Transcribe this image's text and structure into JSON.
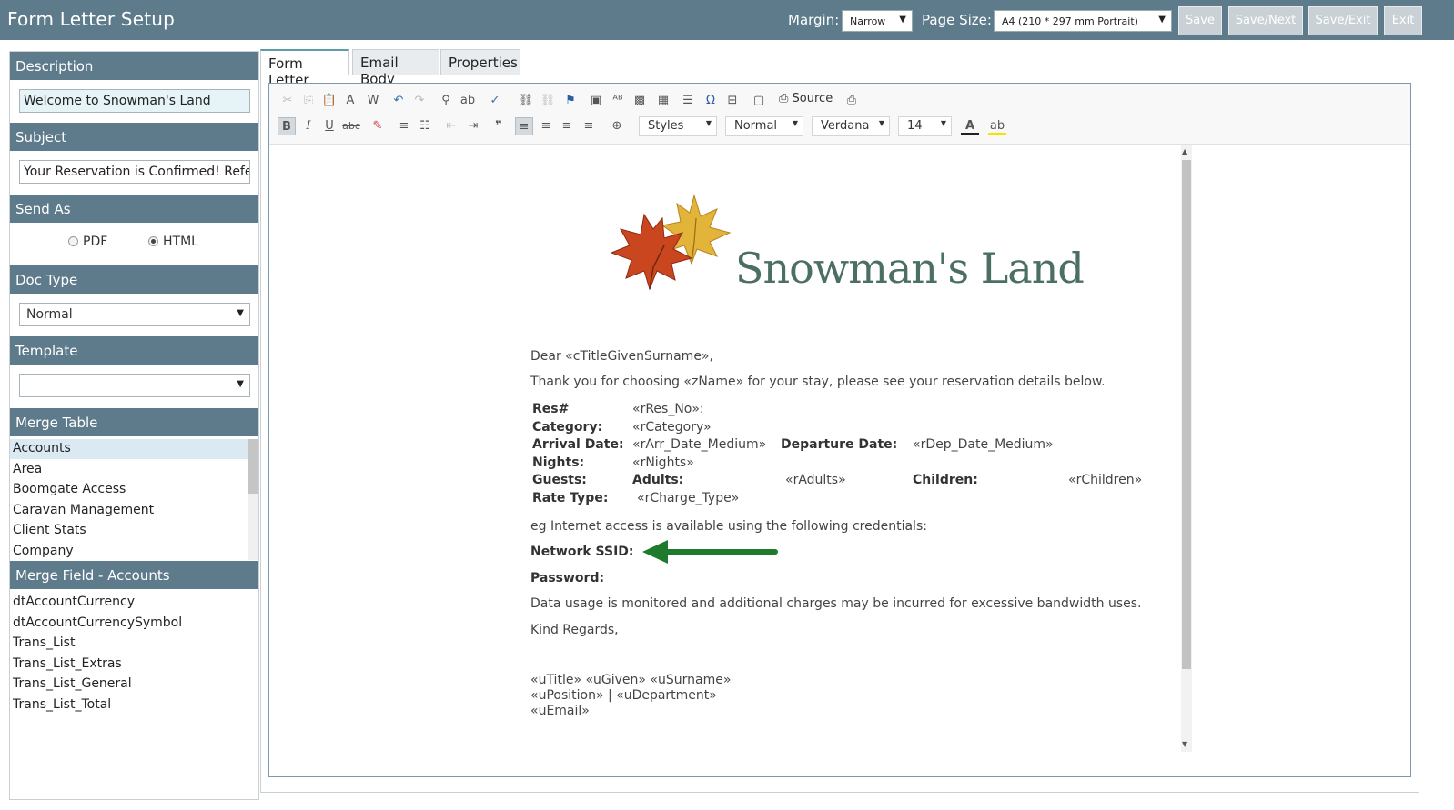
{
  "header": {
    "title": "Form Letter Setup",
    "margin_label": "Margin:",
    "margin_value": "Narrow",
    "page_size_label": "Page Size:",
    "page_size_value": "A4 (210 * 297 mm Portrait)",
    "buttons": {
      "save": "Save",
      "save_next": "Save/Next",
      "save_exit": "Save/Exit",
      "exit": "Exit"
    }
  },
  "sidebar": {
    "description_label": "Description",
    "description_value": "Welcome to Snowman's Land",
    "subject_label": "Subject",
    "subject_value": "Your Reservation is Confirmed! Refe",
    "send_as_label": "Send As",
    "send_as_options": {
      "pdf": "PDF",
      "html": "HTML"
    },
    "doc_type_label": "Doc Type",
    "doc_type_value": "Normal",
    "template_label": "Template",
    "template_value": "",
    "merge_table_label": "Merge Table",
    "merge_table_items": [
      "Accounts",
      "Area",
      "Boomgate Access",
      "Caravan Management",
      "Client Stats",
      "Company"
    ],
    "merge_field_label": "Merge Field - Accounts",
    "merge_field_items": [
      "dtAccountCurrency",
      "dtAccountCurrencySymbol",
      "Trans_List",
      "Trans_List_Extras",
      "Trans_List_General",
      "Trans_List_Total"
    ]
  },
  "tabs": {
    "form_letter": "Form Letter",
    "email_body": "Email Body",
    "properties": "Properties"
  },
  "toolbar": {
    "source": "Source",
    "styles": "Styles",
    "format": "Normal",
    "font": "Verdana",
    "size": "14"
  },
  "letter": {
    "logo_text": "Snowman's Land",
    "greeting": "Dear «cTitleGivenSurname»,",
    "intro": "Thank you for choosing «zName» for your stay, please see your reservation details below.",
    "res_label": "Res#",
    "res_value": "«rRes_No»:",
    "category_label": "Category:",
    "category_value": "«rCategory»",
    "arrival_label": "Arrival Date:",
    "arrival_value": "«rArr_Date_Medium»",
    "departure_label": "Departure Date:",
    "departure_value": "«rDep_Date_Medium»",
    "nights_label": "Nights:",
    "nights_value": "«rNights»",
    "guests_label": "Guests:",
    "adults_label": "Adults:",
    "adults_value": "«rAdults»",
    "children_label": "Children:",
    "children_value": "«rChildren»",
    "rate_label": "Rate Type:",
    "rate_value": "«rCharge_Type»",
    "internet_line": "eg Internet access is available using the following credentials:",
    "ssid_label": "Network SSID:",
    "password_label": "Password:",
    "usage_line": "Data usage is monitored and additional charges may be incurred for excessive bandwidth uses.",
    "regards": "Kind Regards,",
    "sig_name": "«uTitle» «uGiven» «uSurname»",
    "sig_position": "«uPosition» | «uDepartment»",
    "sig_email": "«uEmail»"
  }
}
